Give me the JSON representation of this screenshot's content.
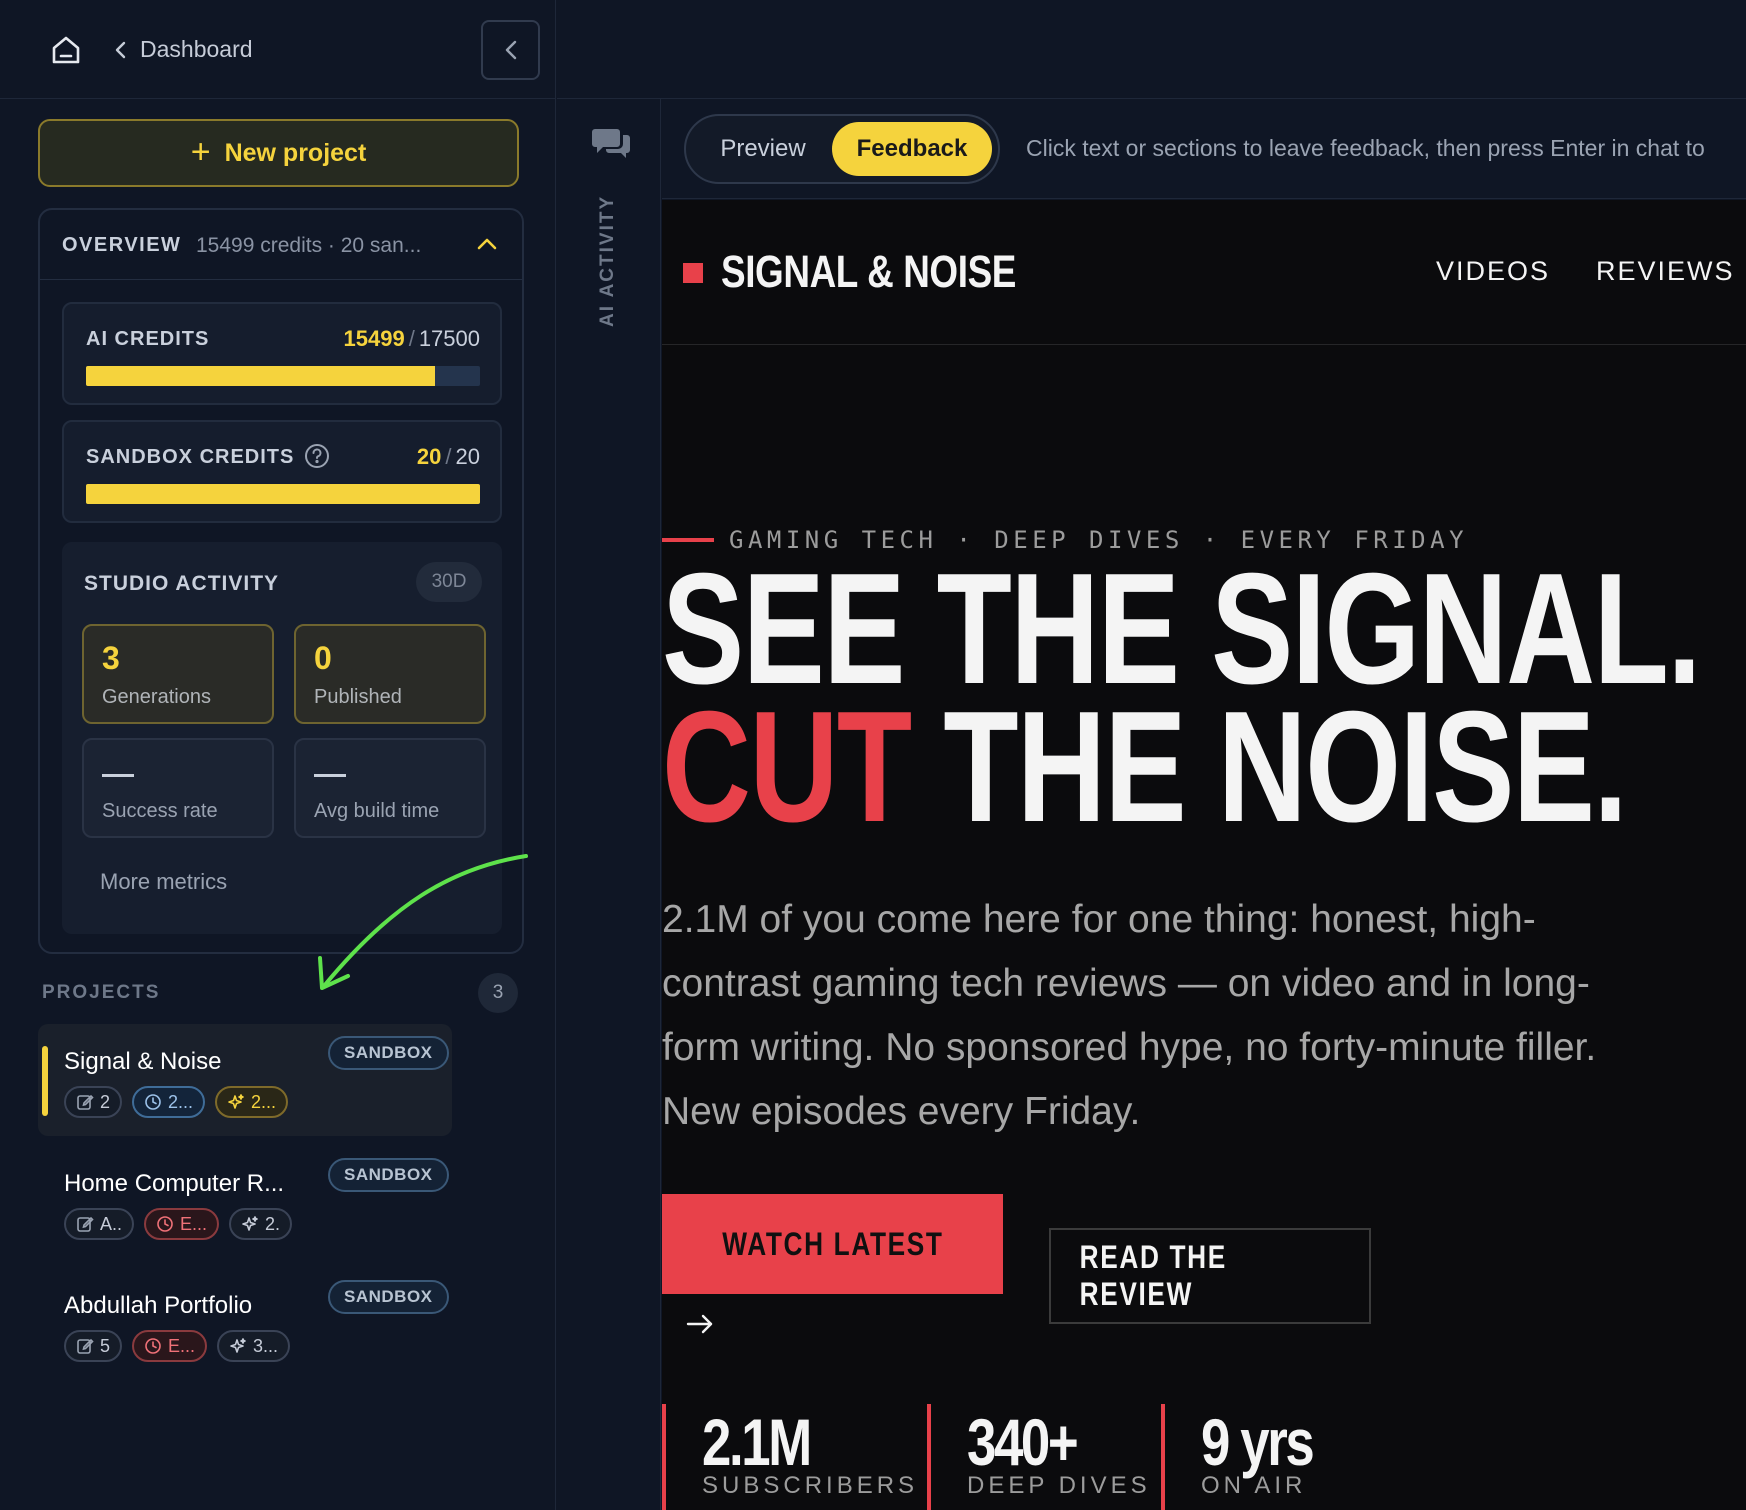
{
  "header": {
    "breadcrumb": "Dashboard"
  },
  "sidebar": {
    "new_project": "New project",
    "overview": {
      "label": "OVERVIEW",
      "summary": "15499 credits · 20 san..."
    },
    "ai_credits": {
      "label": "AI CREDITS",
      "used": "15499",
      "total": "17500",
      "fraction": 0.886
    },
    "sandbox_credits": {
      "label": "SANDBOX CREDITS",
      "used": "20",
      "total": "20",
      "fraction": 1.0
    },
    "activity": {
      "title": "STUDIO ACTIVITY",
      "range": "30D",
      "metrics": [
        {
          "value": "3",
          "label": "Generations"
        },
        {
          "value": "0",
          "label": "Published"
        },
        {
          "value": "—",
          "label": "Success rate"
        },
        {
          "value": "—",
          "label": "Avg build time"
        }
      ],
      "more": "More metrics"
    },
    "projects": {
      "label": "PROJECTS",
      "count": "3",
      "items": [
        {
          "name": "Signal & Noise",
          "tag": "SANDBOX",
          "chips": [
            "2",
            "2...",
            "2..."
          ]
        },
        {
          "name": "Home Computer R...",
          "tag": "SANDBOX",
          "chips": [
            "A..",
            "E...",
            "2."
          ]
        },
        {
          "name": "Abdullah Portfolio",
          "tag": "SANDBOX",
          "chips": [
            "5",
            "E...",
            "3..."
          ]
        }
      ]
    }
  },
  "strip": {
    "label": "AI ACTIVITY"
  },
  "toolbar": {
    "preview": "Preview",
    "feedback": "Feedback",
    "hint": "Click text or sections to leave feedback, then press Enter in chat to"
  },
  "site": {
    "brand": "SIGNAL & NOISE",
    "nav": [
      "VIDEOS",
      "REVIEWS"
    ],
    "eyebrow": "GAMING TECH · DEEP DIVES · EVERY FRIDAY",
    "hero_line1": "SEE THE SIGNAL.",
    "hero_red": "CUT",
    "hero_line2_rest": " THE NOISE.",
    "lede": "2.1M of you come here for one thing: honest, high-contrast gaming tech reviews — on video and in long-form writing. No sponsored hype, no forty-minute filler. New episodes every Friday.",
    "cta_primary": "WATCH LATEST",
    "cta_secondary": "READ THE REVIEW",
    "stats": [
      {
        "value": "2.1M",
        "label": "SUBSCRIBERS"
      },
      {
        "value": "340+",
        "label": "DEEP DIVES"
      },
      {
        "value": "9 yrs",
        "label": "ON AIR"
      }
    ]
  },
  "colors": {
    "accent_yellow": "#f5d33d",
    "accent_red": "#e8414a",
    "annotation_green": "#5ee24b"
  }
}
